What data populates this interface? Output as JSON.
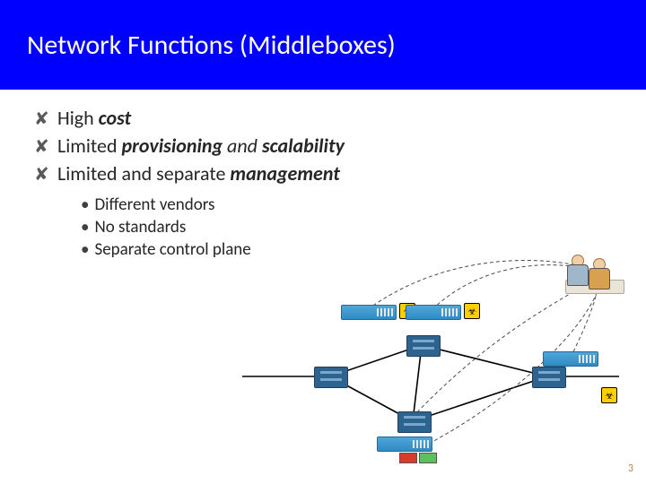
{
  "title": "Network Functions (Middleboxes)",
  "bullets": [
    {
      "mark": "✘",
      "segments": [
        {
          "text": "High ",
          "style": "plain"
        },
        {
          "text": "cost",
          "style": "bold-italic"
        }
      ]
    },
    {
      "mark": "✘",
      "segments": [
        {
          "text": "Limited ",
          "style": "plain"
        },
        {
          "text": "provisioning",
          "style": "bold-italic"
        },
        {
          "text": " and ",
          "style": "italic"
        },
        {
          "text": "scalability",
          "style": "bold-italic"
        }
      ]
    },
    {
      "mark": "✘",
      "segments": [
        {
          "text": "Limited and separate ",
          "style": "plain"
        },
        {
          "text": "management",
          "style": "bold-italic"
        }
      ]
    }
  ],
  "sub_items": [
    "Different vendors",
    "No standards",
    "Separate control plane"
  ],
  "page_number": "3",
  "diagram": {
    "semantic": "network-topology-with-middleboxes-and-admin",
    "routers": [
      "r1",
      "r2",
      "r3",
      "r4"
    ],
    "appliances": [
      "firewall-1",
      "firewall-2",
      "firewall-3",
      "firewall-4"
    ],
    "admins_label": "operators"
  }
}
